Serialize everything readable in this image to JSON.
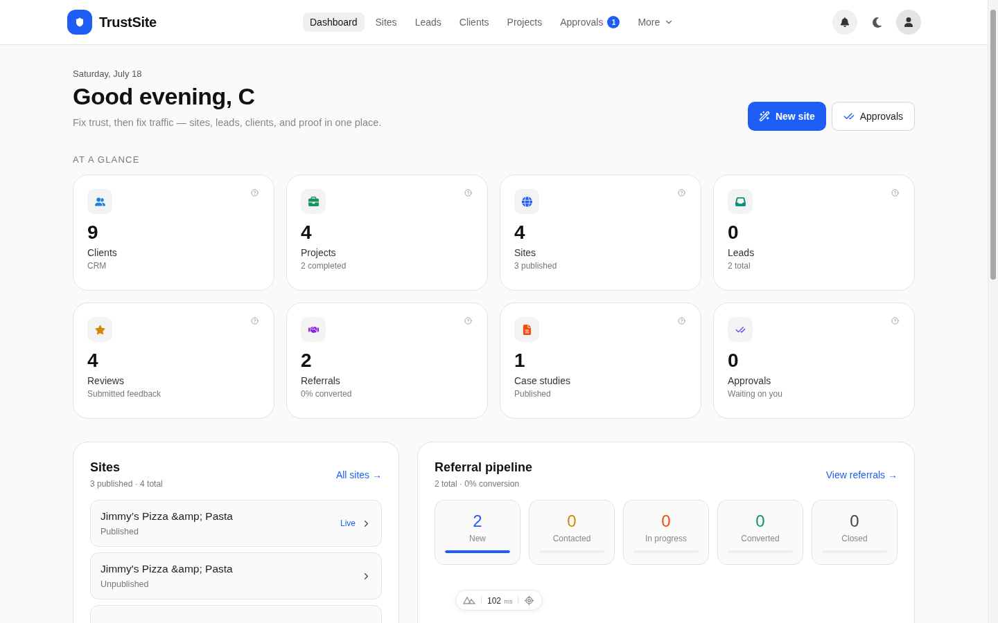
{
  "brand": {
    "name": "TrustSite"
  },
  "nav": [
    {
      "label": "Dashboard",
      "selected": true
    },
    {
      "label": "Sites",
      "selected": false
    },
    {
      "label": "Leads",
      "selected": false
    },
    {
      "label": "Clients",
      "selected": false
    },
    {
      "label": "Projects",
      "selected": false
    },
    {
      "label": "Approvals",
      "selected": false,
      "badge": "1"
    },
    {
      "label": "More",
      "selected": false,
      "kind": "menu"
    }
  ],
  "header": {
    "date": "Saturday, July 18",
    "greeting": "Good evening, C",
    "subtitle": "Fix trust, then fix traffic — sites, leads, clients, and proof in one place.",
    "primary_button": "New site",
    "secondary_button": "Approvals"
  },
  "glance": {
    "title": "AT A GLANCE",
    "cards": [
      {
        "color": "#1d7fe0",
        "value": "9",
        "label": "Clients",
        "note": "CRM"
      },
      {
        "color": "#16955e",
        "value": "4",
        "label": "Projects",
        "note": "2 completed"
      },
      {
        "color": "#1e5ef5",
        "value": "4",
        "label": "Sites",
        "note": "3 published"
      },
      {
        "color": "#0e8f7e",
        "value": "0",
        "label": "Leads",
        "note": "2 total"
      },
      {
        "color": "#d48806",
        "value": "4",
        "label": "Reviews",
        "note": "Submitted feedback"
      },
      {
        "color": "#8a1fe0",
        "value": "2",
        "label": "Referrals",
        "note": "0% converted"
      },
      {
        "color": "#f04e0e",
        "value": "1",
        "label": "Case studies",
        "note": "Published"
      },
      {
        "color": "#5b3df0",
        "value": "0",
        "label": "Approvals",
        "note": "Waiting on you"
      }
    ]
  },
  "sites": {
    "title": "Sites",
    "summary": "3 published · 4 total",
    "link": "All sites →",
    "items": [
      {
        "kind": "site",
        "name": "Jimmy’s Pizza &amp; Pasta",
        "status": "Published",
        "live": "Live"
      },
      {
        "kind": "site",
        "name": "Jimmy's Pizza &amp; Pasta",
        "status": "Unpublished"
      },
      {
        "kind": "cut"
      }
    ]
  },
  "referrals": {
    "title": "Referral pipeline",
    "summary": "2 total · 0% conversion",
    "link": "View referrals →",
    "stages": [
      {
        "count": "2",
        "label": "New",
        "color": "#1e5ef5",
        "level": 1
      },
      {
        "count": "0",
        "label": "Contacted",
        "color": "#d48806",
        "level": 0
      },
      {
        "count": "0",
        "label": "In progress",
        "color": "#f04e0e",
        "level": 0
      },
      {
        "count": "0",
        "label": "Converted",
        "color": "#16955e",
        "level": 0
      },
      {
        "count": "0",
        "label": "Closed",
        "color": "#3f4450",
        "level": 0
      }
    ]
  },
  "devtools": {
    "value": "102",
    "unit": "ms"
  }
}
